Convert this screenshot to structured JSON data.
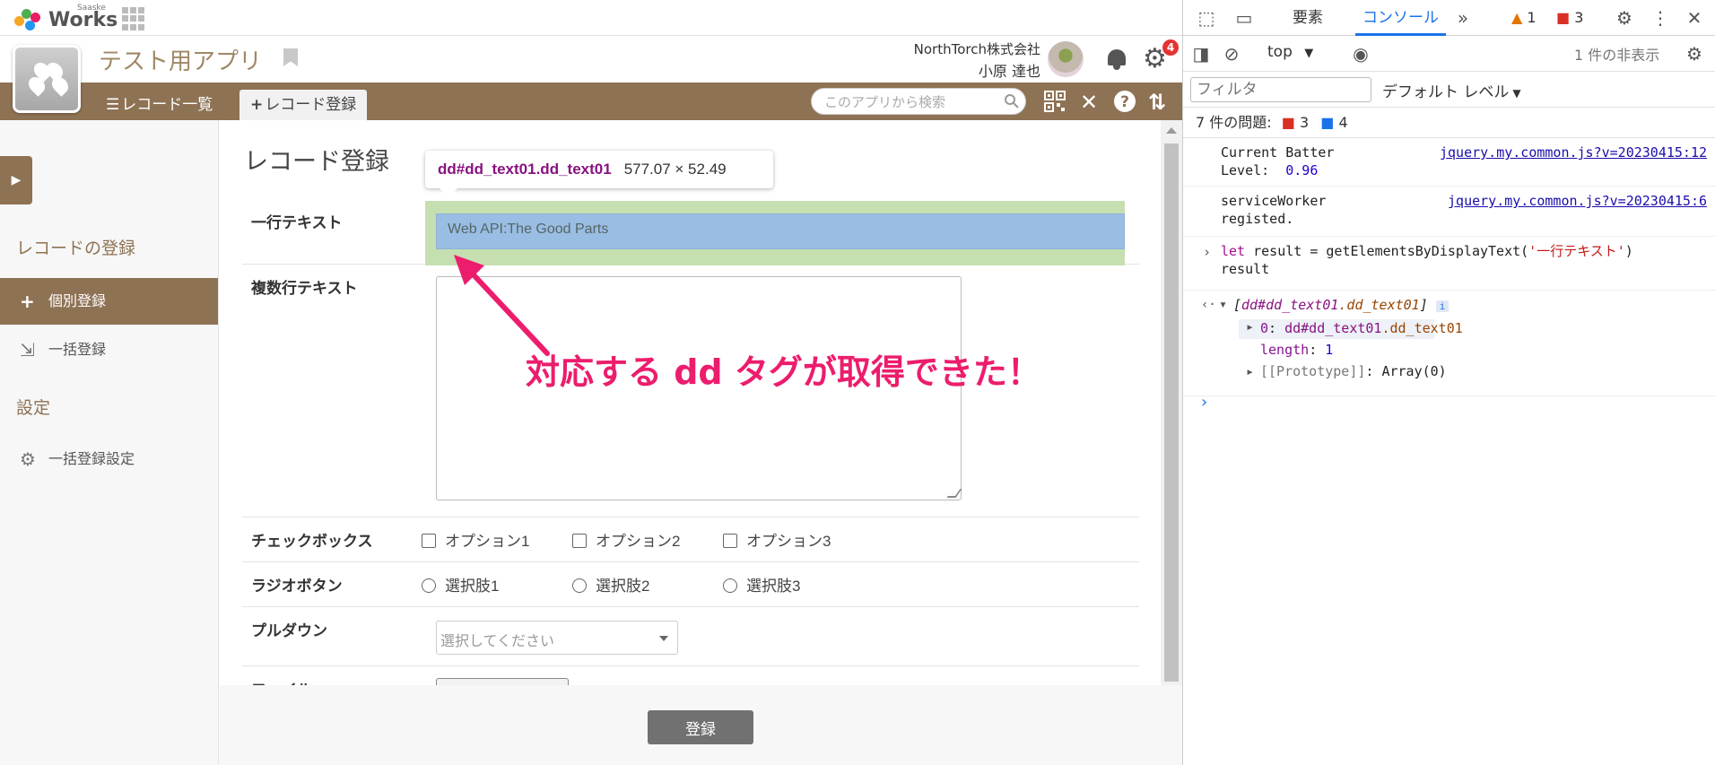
{
  "colors": {
    "brand": "#8e7254",
    "highlight_green": "#c5dfb1",
    "highlight_blue": "#99bde3",
    "annotation": "#ec1d6d",
    "devtools_accent": "#1a73e8"
  },
  "topbar": {
    "brand_small": "Saaske",
    "brand": "Works",
    "apps_icon": "grid-icon"
  },
  "header": {
    "app_title": "テスト用アプリ",
    "company": "NorthTorch株式会社",
    "user": "小原 達也",
    "notification_count": "4"
  },
  "nav": {
    "tab_list": "レコード一覧",
    "tab_add": "レコード登録",
    "search_placeholder": "このアプリから検索"
  },
  "sidebar": {
    "heading_register": "レコードの登録",
    "item_single": "個別登録",
    "item_bulk": "一括登録",
    "heading_settings": "設定",
    "item_bulk_settings": "一括登録設定"
  },
  "form": {
    "title": "レコード登録",
    "field_text_label": "一行テキスト",
    "field_text_value": "Web API:The Good Parts",
    "field_textarea_label": "複数行テキスト",
    "field_checkbox_label": "チェックボックス",
    "checkbox_options": [
      "オプション1",
      "オプション2",
      "オプション3"
    ],
    "field_radio_label": "ラジオボタン",
    "radio_options": [
      "選択肢1",
      "選択肢2",
      "選択肢3"
    ],
    "field_select_label": "プルダウン",
    "select_placeholder": "選択してください",
    "field_file_label": "ファイル",
    "submit": "登録"
  },
  "tooltip": {
    "selector": "dd#dd_text01.dd_text01",
    "size": "577.07 × 52.49"
  },
  "annotation": "対応する dd タグが取得できた！",
  "devtools": {
    "tab_elements": "要素",
    "tab_console": "コンソール",
    "warn_count": "1",
    "err_count": "3",
    "context": "top",
    "hidden_count": "1 件の非表示",
    "filter_placeholder": "フィルタ",
    "level": "デフォルト レベル",
    "issues_label": "7 件の問題:",
    "issues_err": "3",
    "issues_info": "4",
    "log1_line1": "Current Batter",
    "log1_line2_key": "Level:",
    "log1_line2_val": "0.96",
    "log1_src": "jquery.my.common.js?v=20230415:12",
    "log2_line1": "serviceWorker",
    "log2_line2": "registed.",
    "log2_src": "jquery.my.common.js?v=20230415:6",
    "cmd_let": "let",
    "cmd_body": " result = getElementsByDisplayText(",
    "cmd_arg": "'一行テキスト'",
    "cmd_close": ")",
    "cmd_line2": "result",
    "res_open": "[",
    "res_node": "dd",
    "res_id": "#dd_text01",
    "res_class": ".dd_text01",
    "res_close": "]",
    "res_index": "0",
    "res_length_key": "length",
    "res_length_val": "1",
    "res_proto_key": "[[Prototype]]",
    "res_proto_val": "Array(0)"
  }
}
